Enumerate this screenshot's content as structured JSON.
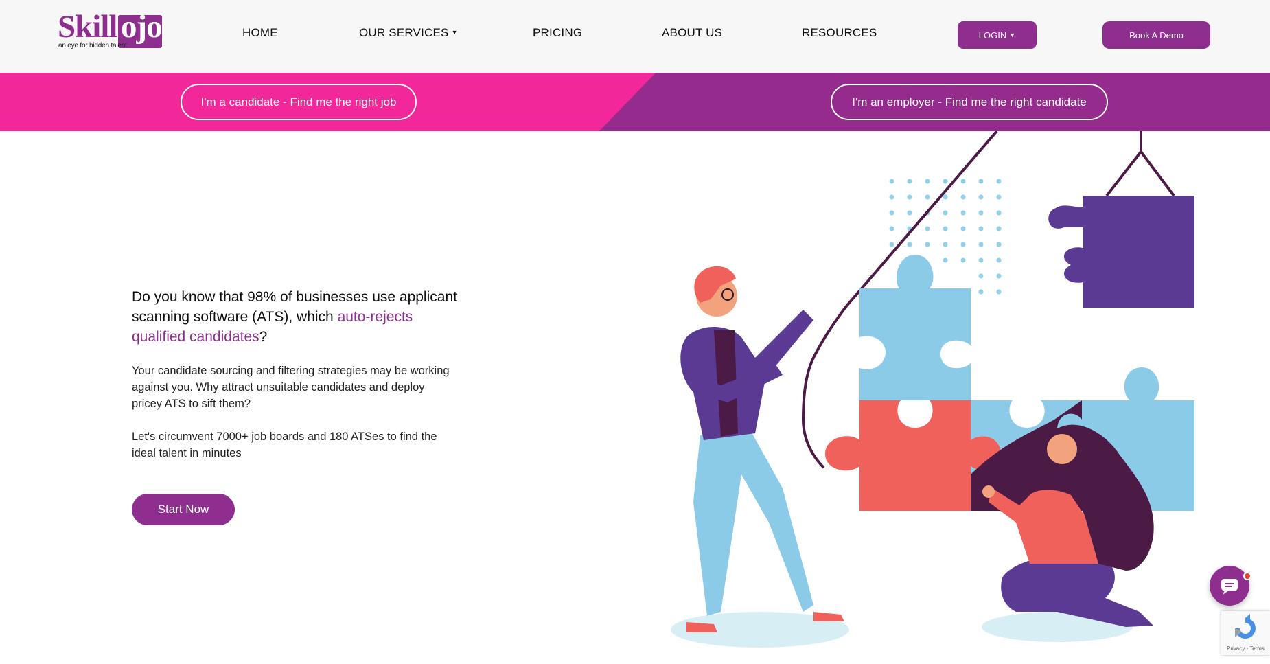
{
  "brand": {
    "logo_skill": "Skill",
    "logo_ojo": "ojo",
    "tagline": "an eye for hidden talent",
    "primary_color": "#8e2f8f",
    "pink_color": "#f1279a",
    "purple_band_color": "#952c8d"
  },
  "nav": {
    "home": "HOME",
    "services": "OUR SERVICES",
    "pricing": "PRICING",
    "about": "ABOUT US",
    "resources": "RESOURCES",
    "login": "LOGIN",
    "demo": "Book A Demo"
  },
  "banner": {
    "candidate": "I'm a candidate - Find me the right job",
    "employer": "I'm an employer - Find me the right candidate"
  },
  "hero": {
    "headline_part1": "Do you know that 98% of businesses use applicant scanning software (ATS), which ",
    "headline_highlight": "auto-rejects qualified candidates",
    "headline_end": "?",
    "paragraph1": "Your candidate sourcing and filtering strategies may be working against you. Why attract unsuitable candidates and deploy pricey ATS to sift them?",
    "paragraph2": "Let's circumvent 7000+ job boards and 180 ATSes to find the ideal talent in minutes",
    "cta": "Start Now"
  },
  "widgets": {
    "chat_icon": "chat-bubble-icon",
    "recaptcha_terms": "Privacy - Terms"
  }
}
